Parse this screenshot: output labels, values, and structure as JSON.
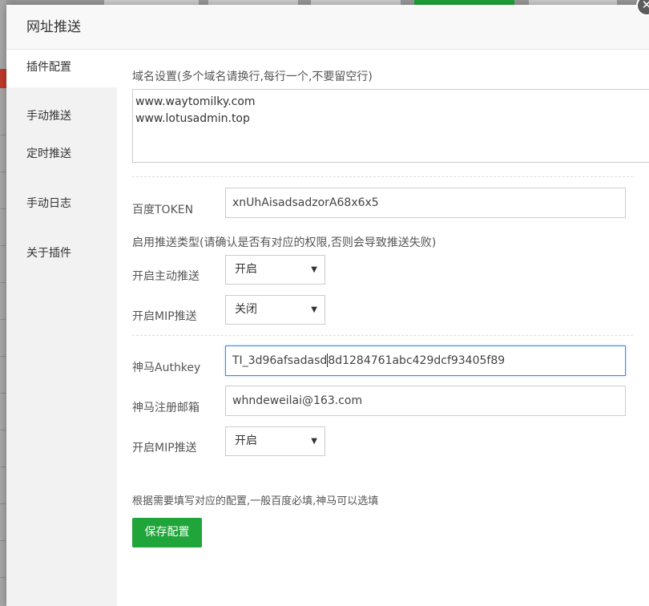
{
  "dialog": {
    "title": "网址推送",
    "close_glyph": "✕"
  },
  "sidebar": {
    "items": [
      {
        "label": "插件配置",
        "active": true
      },
      {
        "label": "手动推送",
        "active": false
      },
      {
        "label": "定时推送",
        "active": false
      },
      {
        "label": "手动日志",
        "active": false
      },
      {
        "label": "关于插件",
        "active": false
      }
    ]
  },
  "form": {
    "domain_label": "域名设置(多个域名请换行,每行一个,不要留空行)",
    "domains": "www.waytomilky.com\nwww.lotusadmin.top",
    "baidu_token_label": "百度TOKEN",
    "baidu_token_value": "xnUhAisadsadzorA68x6x5",
    "push_type_label": "启用推送类型(请确认是否有对应的权限,否则会导致推送失败)",
    "active_push_label": "开启主动推送",
    "active_push_value": "开启",
    "mip_push_label": "开启MIP推送",
    "mip_push_value": "关闭",
    "shenma_authkey_label": "神马Authkey",
    "shenma_authkey_before_caret": "TI_3d96afsadasd",
    "shenma_authkey_after_caret": "8d1284761abc429dcf93405f89",
    "shenma_email_label": "神马注册邮箱",
    "shenma_email_value": "whndeweilai@163.com",
    "shenma_mip_label": "开启MIP推送",
    "shenma_mip_value": "开启",
    "note": "根据需要填写对应的配置,一般百度必填,神马可以选填",
    "save_label": "保存配置"
  },
  "icons": {
    "dropdown_arrow": "▼"
  },
  "colors": {
    "accent_green": "#20a53a",
    "focus_blue": "#3b8de0"
  }
}
